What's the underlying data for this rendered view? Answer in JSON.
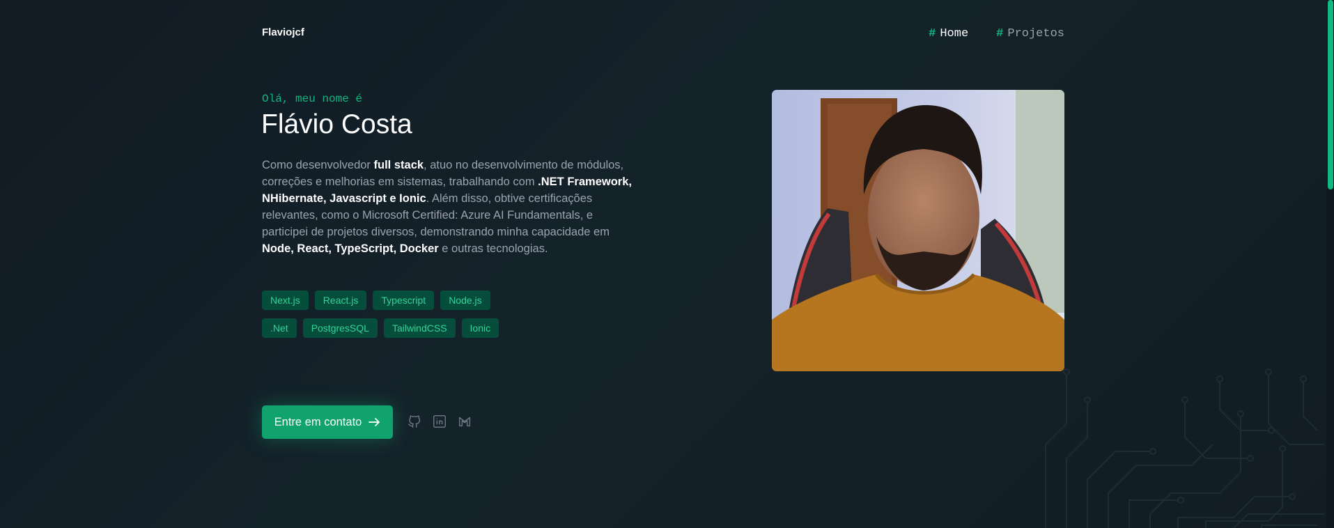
{
  "header": {
    "logo": "Flaviojcf",
    "nav": [
      {
        "hash": "#",
        "label": "Home",
        "active": true
      },
      {
        "hash": "#",
        "label": "Projetos",
        "active": false
      }
    ]
  },
  "hero": {
    "greeting": "Olá, meu nome é",
    "name": "Flávio Costa",
    "bio": [
      {
        "text": "Como desenvolvedor ",
        "bold": false
      },
      {
        "text": "full stack",
        "bold": true
      },
      {
        "text": ", atuo no desenvolvimento de módulos, correções e melhorias em sistemas, trabalhando com ",
        "bold": false
      },
      {
        "text": ".NET Framework, NHibernate, Javascript e Ionic",
        "bold": true
      },
      {
        "text": ". Além disso, obtive certificações relevantes, como o Microsoft Certified: Azure AI Fundamentals, e participei de projetos diversos, demonstrando minha capacidade em ",
        "bold": false
      },
      {
        "text": "Node, React, TypeScript, Docker",
        "bold": true
      },
      {
        "text": " e outras tecnologias.",
        "bold": false
      }
    ],
    "tags": [
      "Next.js",
      "React.js",
      "Typescript",
      "Node.js",
      ".Net",
      "PostgresSQL",
      "TailwindCSS",
      "Ionic"
    ],
    "cta_label": "Entre em contato",
    "cta_icon": "arrow-right-icon",
    "socials": [
      "github-icon",
      "linkedin-icon",
      "gmail-icon"
    ]
  },
  "colors": {
    "accent": "#10b981",
    "tag_bg": "#064e3b",
    "tag_text": "#34d399",
    "background": "#111b24"
  }
}
